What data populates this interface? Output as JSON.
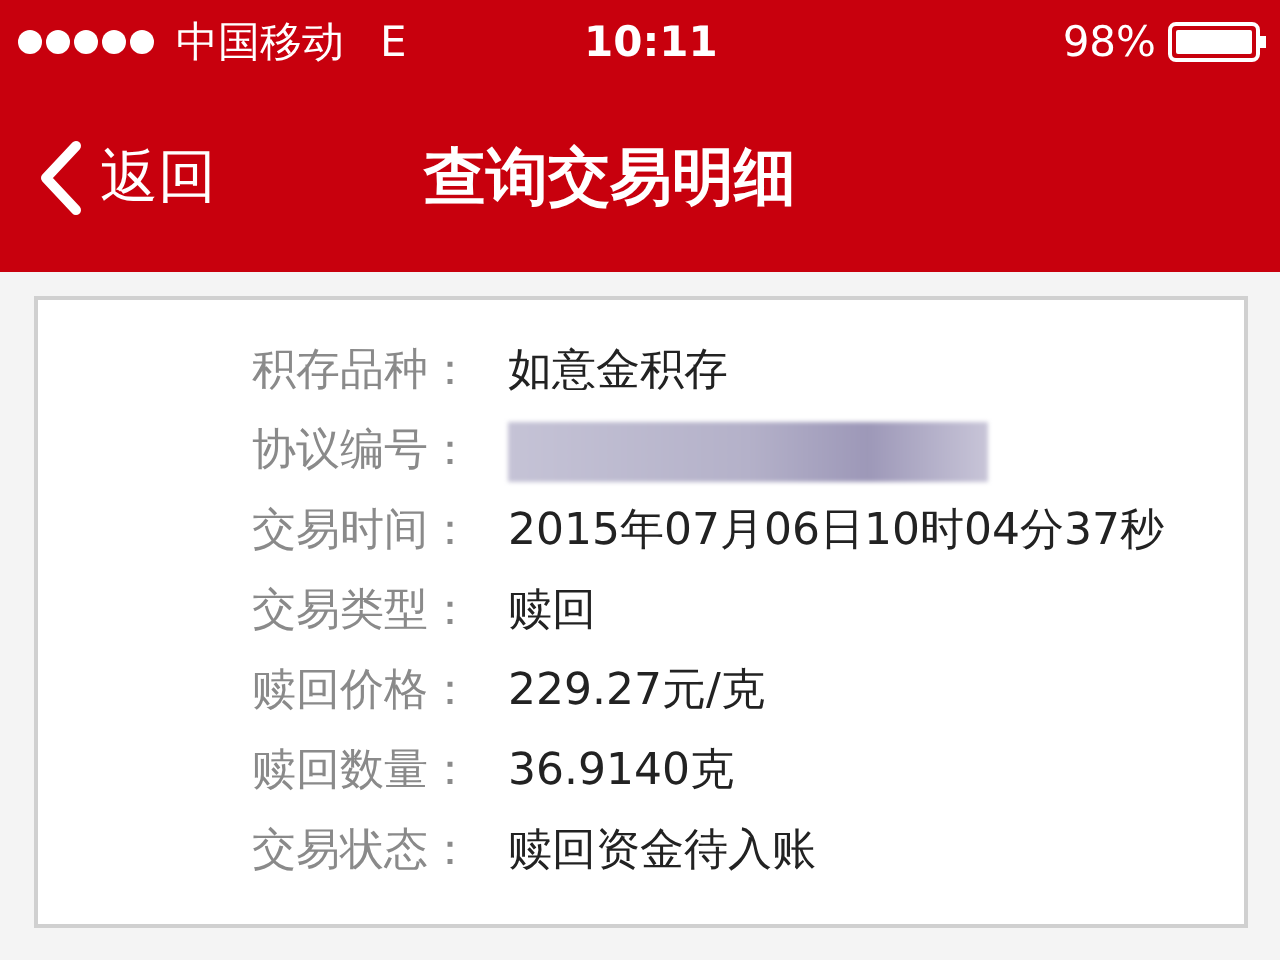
{
  "status_bar": {
    "carrier": "中国移动",
    "network": "E",
    "time": "10:11",
    "battery": "98%"
  },
  "nav_bar": {
    "back": "返回",
    "title": "查询交易明细"
  },
  "details": [
    {
      "kind": "text",
      "label": "积存品种：",
      "value": "如意金积存"
    },
    {
      "kind": "redacted",
      "label": "协议编号："
    },
    {
      "kind": "text",
      "label": "交易时间：",
      "value": "2015年07月06日10时04分37秒"
    },
    {
      "kind": "text",
      "label": "交易类型：",
      "value": "赎回"
    },
    {
      "kind": "text",
      "label": "赎回价格：",
      "value": "229.27元/克"
    },
    {
      "kind": "text",
      "label": "赎回数量：",
      "value": "36.9140克"
    },
    {
      "kind": "text",
      "label": "交易状态：",
      "value": "赎回资金待入账"
    }
  ]
}
